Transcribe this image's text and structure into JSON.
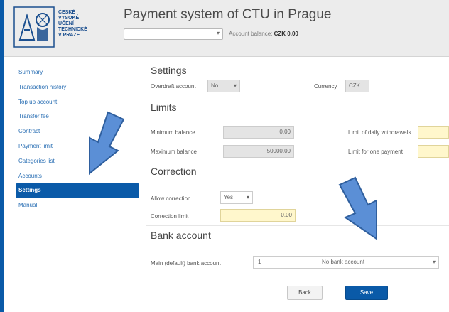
{
  "header": {
    "title": "Payment system of CTU in Prague",
    "logo_lines": [
      "ČESKÉ",
      "VYSOKÉ",
      "UČENÍ",
      "TECHNICKÉ",
      "V PRAZE"
    ],
    "account_select": {
      "value": "",
      "caret": "▾"
    },
    "balance_label": "Account balance:",
    "balance_value": "CZK 0.00"
  },
  "sidebar": {
    "items": [
      {
        "label": "Summary"
      },
      {
        "label": "Transaction history"
      },
      {
        "label": "Top up account"
      },
      {
        "label": "Transfer fee"
      },
      {
        "label": "Contract"
      },
      {
        "label": "Payment limit"
      },
      {
        "label": "Categories list"
      },
      {
        "label": "Accounts"
      },
      {
        "label": "Settings",
        "active": true
      },
      {
        "label": "Manual"
      }
    ]
  },
  "settings": {
    "title": "Settings",
    "overdraft_label": "Overdraft account",
    "overdraft_value": "No",
    "currency_label": "Currency",
    "currency_value": "CZK"
  },
  "limits": {
    "title": "Limits",
    "min_balance_label": "Minimum balance",
    "min_balance_value": "0.00",
    "max_balance_label": "Maximum balance",
    "max_balance_value": "50000.00",
    "limit_transfers_label": "Limit of daily withdrawals",
    "limit_transfers_value": "",
    "limit_payment_label": "Limit for one payment",
    "limit_payment_value": ""
  },
  "correction": {
    "title": "Correction",
    "allow_label": "Allow correction",
    "allow_value": "Yes",
    "amount_label": "Correction limit",
    "amount_value": "0.00"
  },
  "bank": {
    "title": "Bank account",
    "select_label": "Main (default) bank account",
    "select_number": "1",
    "select_value": "No bank account",
    "caret": "▾"
  },
  "buttons": {
    "back": "Back",
    "save": "Save"
  },
  "colors": {
    "accent": "#0a5aa8",
    "arrow": "#5b8fd6",
    "arrow_outline": "#2f5f9e"
  }
}
